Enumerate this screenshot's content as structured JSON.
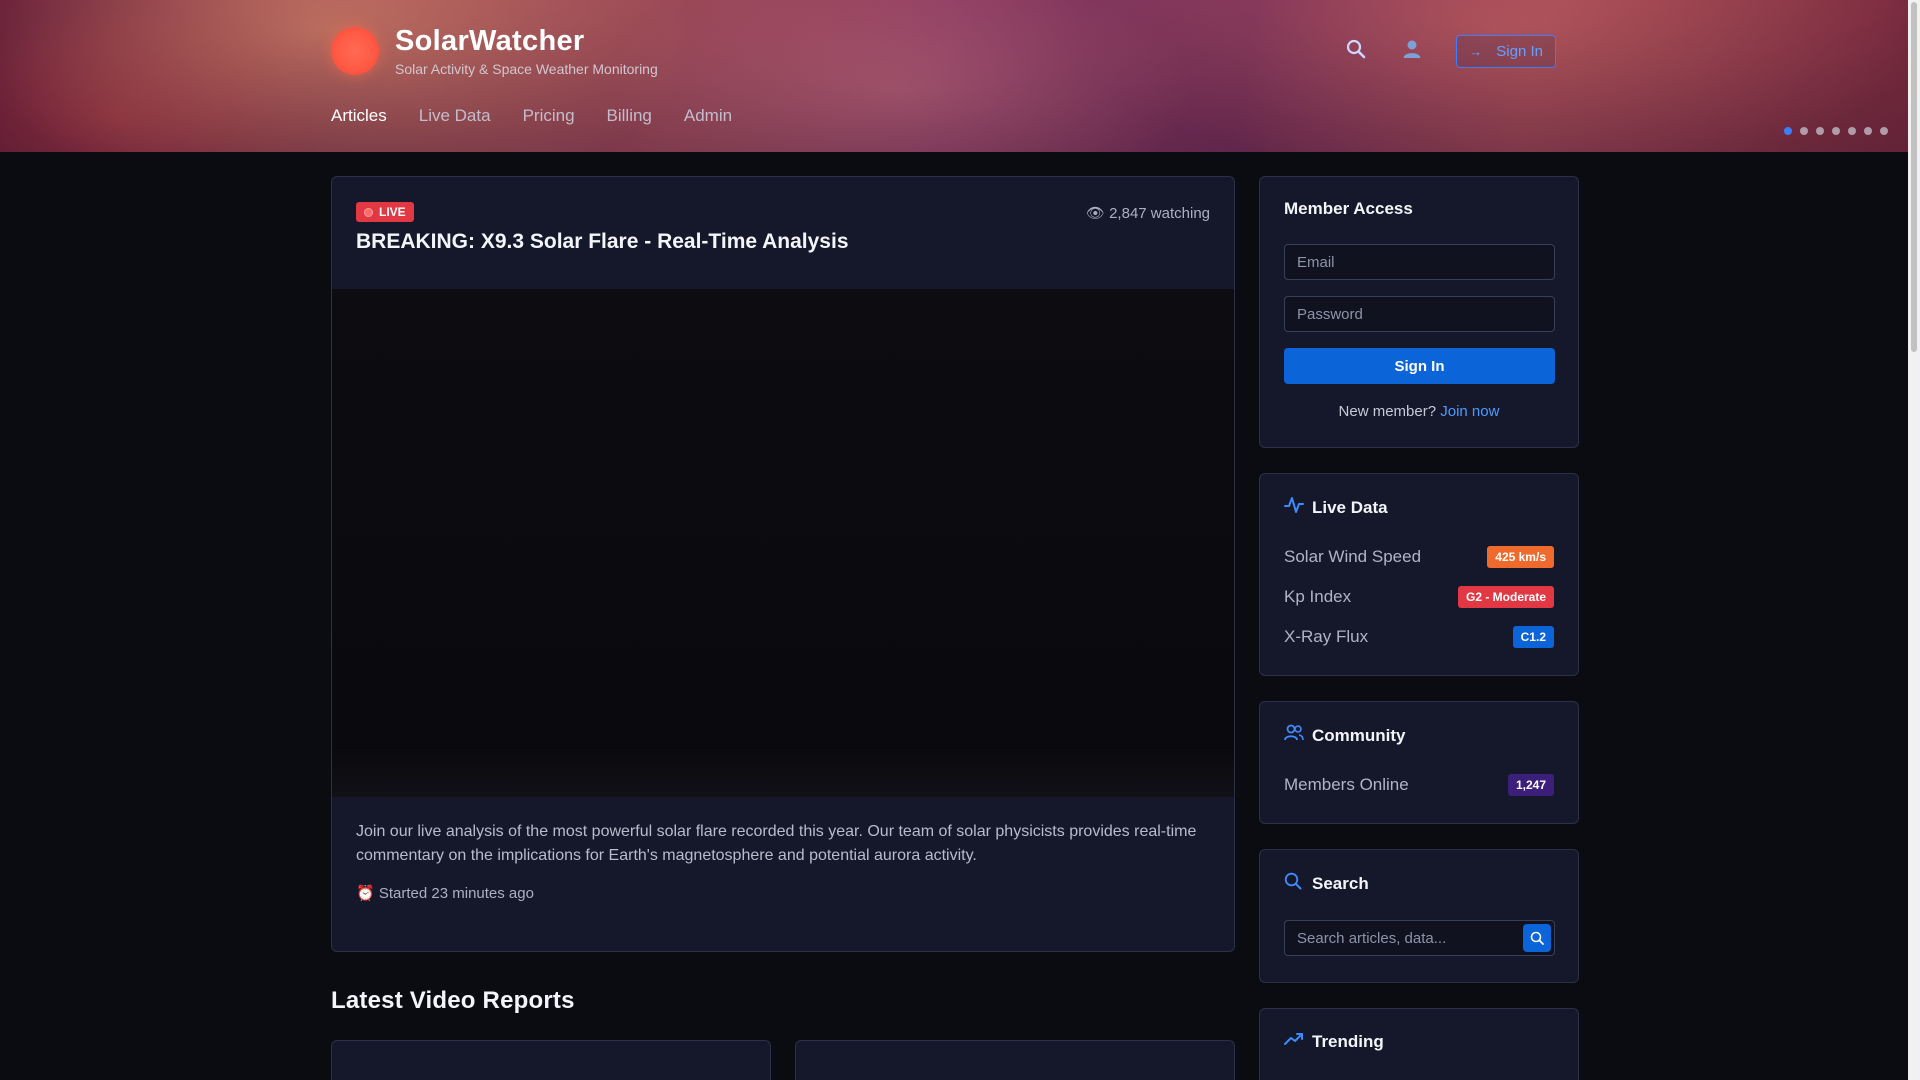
{
  "header": {
    "brand_title": "SolarWatcher",
    "brand_subtitle": "Solar Activity & Space Weather Monitoring",
    "search_icon": "search-icon",
    "user_icon": "user-icon",
    "signin_label": "Sign In",
    "nav": [
      {
        "label": "Articles",
        "active": true
      },
      {
        "label": "Live Data",
        "active": false
      },
      {
        "label": "Pricing",
        "active": false
      },
      {
        "label": "Billing",
        "active": false
      },
      {
        "label": "Admin",
        "active": false
      }
    ],
    "carousel_dots": 7,
    "carousel_active_index": 0
  },
  "live": {
    "badge": "LIVE",
    "watching": "2,847 watching",
    "title": "BREAKING: X9.3 Solar Flare - Real-Time Analysis",
    "description": "Join our live analysis of the most powerful solar flare recorded this year. Our team of solar physicists provides real-time commentary on the implications for Earth's magnetosphere and potential aurora activity.",
    "started": "Started 23 minutes ago"
  },
  "section": {
    "latest_title": "Latest Video Reports"
  },
  "member": {
    "title": "Member Access",
    "email_placeholder": "Email",
    "password_placeholder": "Password",
    "signin_button": "Sign In",
    "new_member_text": "New member?",
    "join_link": "Join now"
  },
  "live_data": {
    "title": "Live Data",
    "rows": [
      {
        "label": "Solar Wind Speed",
        "value": "425 km/s",
        "color": "#ee6a2d"
      },
      {
        "label": "Kp Index",
        "value": "G2 - Moderate",
        "color": "#e23844"
      },
      {
        "label": "X-Ray Flux",
        "value": "C1.2",
        "color": "#0b64d8"
      }
    ]
  },
  "community": {
    "title": "Community",
    "members_label": "Members Online",
    "members_value": "1,247",
    "badge_color": "#3b1f7a"
  },
  "search": {
    "title": "Search",
    "placeholder": "Search articles, data..."
  },
  "trending": {
    "title": "Trending"
  },
  "colors": {
    "accent": "#3d8bff",
    "primary_button": "#0b64d8",
    "live_red": "#e23844"
  }
}
